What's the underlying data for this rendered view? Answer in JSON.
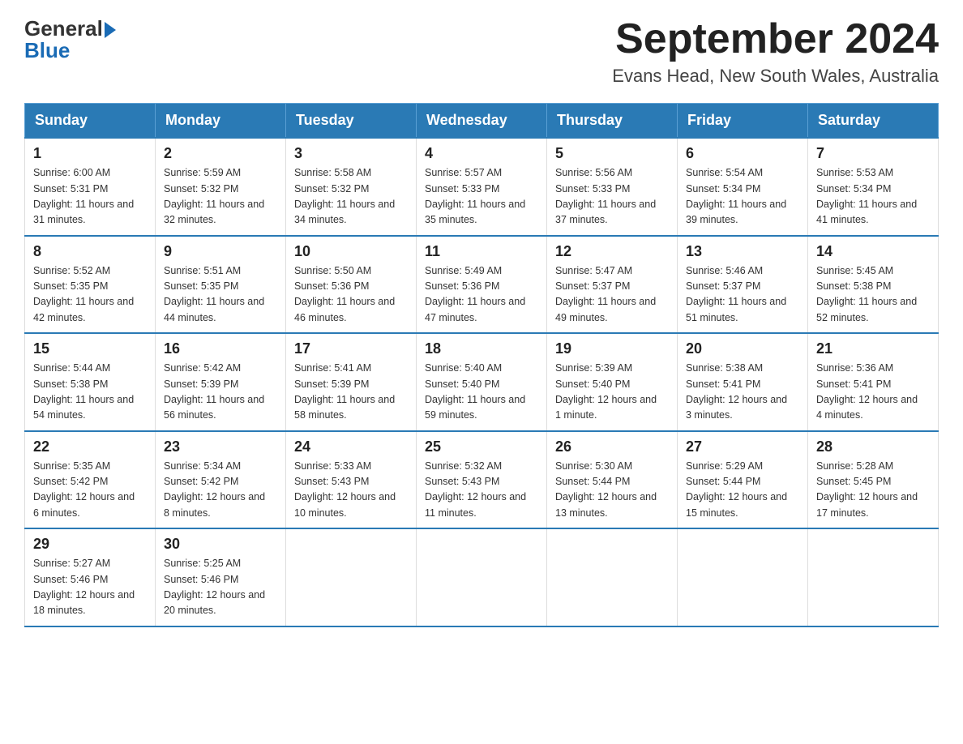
{
  "logo": {
    "general": "General",
    "blue": "Blue"
  },
  "title": "September 2024",
  "location": "Evans Head, New South Wales, Australia",
  "days_of_week": [
    "Sunday",
    "Monday",
    "Tuesday",
    "Wednesday",
    "Thursday",
    "Friday",
    "Saturday"
  ],
  "weeks": [
    [
      {
        "day": "1",
        "sunrise": "6:00 AM",
        "sunset": "5:31 PM",
        "daylight": "11 hours and 31 minutes."
      },
      {
        "day": "2",
        "sunrise": "5:59 AM",
        "sunset": "5:32 PM",
        "daylight": "11 hours and 32 minutes."
      },
      {
        "day": "3",
        "sunrise": "5:58 AM",
        "sunset": "5:32 PM",
        "daylight": "11 hours and 34 minutes."
      },
      {
        "day": "4",
        "sunrise": "5:57 AM",
        "sunset": "5:33 PM",
        "daylight": "11 hours and 35 minutes."
      },
      {
        "day": "5",
        "sunrise": "5:56 AM",
        "sunset": "5:33 PM",
        "daylight": "11 hours and 37 minutes."
      },
      {
        "day": "6",
        "sunrise": "5:54 AM",
        "sunset": "5:34 PM",
        "daylight": "11 hours and 39 minutes."
      },
      {
        "day": "7",
        "sunrise": "5:53 AM",
        "sunset": "5:34 PM",
        "daylight": "11 hours and 41 minutes."
      }
    ],
    [
      {
        "day": "8",
        "sunrise": "5:52 AM",
        "sunset": "5:35 PM",
        "daylight": "11 hours and 42 minutes."
      },
      {
        "day": "9",
        "sunrise": "5:51 AM",
        "sunset": "5:35 PM",
        "daylight": "11 hours and 44 minutes."
      },
      {
        "day": "10",
        "sunrise": "5:50 AM",
        "sunset": "5:36 PM",
        "daylight": "11 hours and 46 minutes."
      },
      {
        "day": "11",
        "sunrise": "5:49 AM",
        "sunset": "5:36 PM",
        "daylight": "11 hours and 47 minutes."
      },
      {
        "day": "12",
        "sunrise": "5:47 AM",
        "sunset": "5:37 PM",
        "daylight": "11 hours and 49 minutes."
      },
      {
        "day": "13",
        "sunrise": "5:46 AM",
        "sunset": "5:37 PM",
        "daylight": "11 hours and 51 minutes."
      },
      {
        "day": "14",
        "sunrise": "5:45 AM",
        "sunset": "5:38 PM",
        "daylight": "11 hours and 52 minutes."
      }
    ],
    [
      {
        "day": "15",
        "sunrise": "5:44 AM",
        "sunset": "5:38 PM",
        "daylight": "11 hours and 54 minutes."
      },
      {
        "day": "16",
        "sunrise": "5:42 AM",
        "sunset": "5:39 PM",
        "daylight": "11 hours and 56 minutes."
      },
      {
        "day": "17",
        "sunrise": "5:41 AM",
        "sunset": "5:39 PM",
        "daylight": "11 hours and 58 minutes."
      },
      {
        "day": "18",
        "sunrise": "5:40 AM",
        "sunset": "5:40 PM",
        "daylight": "11 hours and 59 minutes."
      },
      {
        "day": "19",
        "sunrise": "5:39 AM",
        "sunset": "5:40 PM",
        "daylight": "12 hours and 1 minute."
      },
      {
        "day": "20",
        "sunrise": "5:38 AM",
        "sunset": "5:41 PM",
        "daylight": "12 hours and 3 minutes."
      },
      {
        "day": "21",
        "sunrise": "5:36 AM",
        "sunset": "5:41 PM",
        "daylight": "12 hours and 4 minutes."
      }
    ],
    [
      {
        "day": "22",
        "sunrise": "5:35 AM",
        "sunset": "5:42 PM",
        "daylight": "12 hours and 6 minutes."
      },
      {
        "day": "23",
        "sunrise": "5:34 AM",
        "sunset": "5:42 PM",
        "daylight": "12 hours and 8 minutes."
      },
      {
        "day": "24",
        "sunrise": "5:33 AM",
        "sunset": "5:43 PM",
        "daylight": "12 hours and 10 minutes."
      },
      {
        "day": "25",
        "sunrise": "5:32 AM",
        "sunset": "5:43 PM",
        "daylight": "12 hours and 11 minutes."
      },
      {
        "day": "26",
        "sunrise": "5:30 AM",
        "sunset": "5:44 PM",
        "daylight": "12 hours and 13 minutes."
      },
      {
        "day": "27",
        "sunrise": "5:29 AM",
        "sunset": "5:44 PM",
        "daylight": "12 hours and 15 minutes."
      },
      {
        "day": "28",
        "sunrise": "5:28 AM",
        "sunset": "5:45 PM",
        "daylight": "12 hours and 17 minutes."
      }
    ],
    [
      {
        "day": "29",
        "sunrise": "5:27 AM",
        "sunset": "5:46 PM",
        "daylight": "12 hours and 18 minutes."
      },
      {
        "day": "30",
        "sunrise": "5:25 AM",
        "sunset": "5:46 PM",
        "daylight": "12 hours and 20 minutes."
      },
      null,
      null,
      null,
      null,
      null
    ]
  ],
  "labels": {
    "sunrise": "Sunrise:",
    "sunset": "Sunset:",
    "daylight": "Daylight:"
  }
}
